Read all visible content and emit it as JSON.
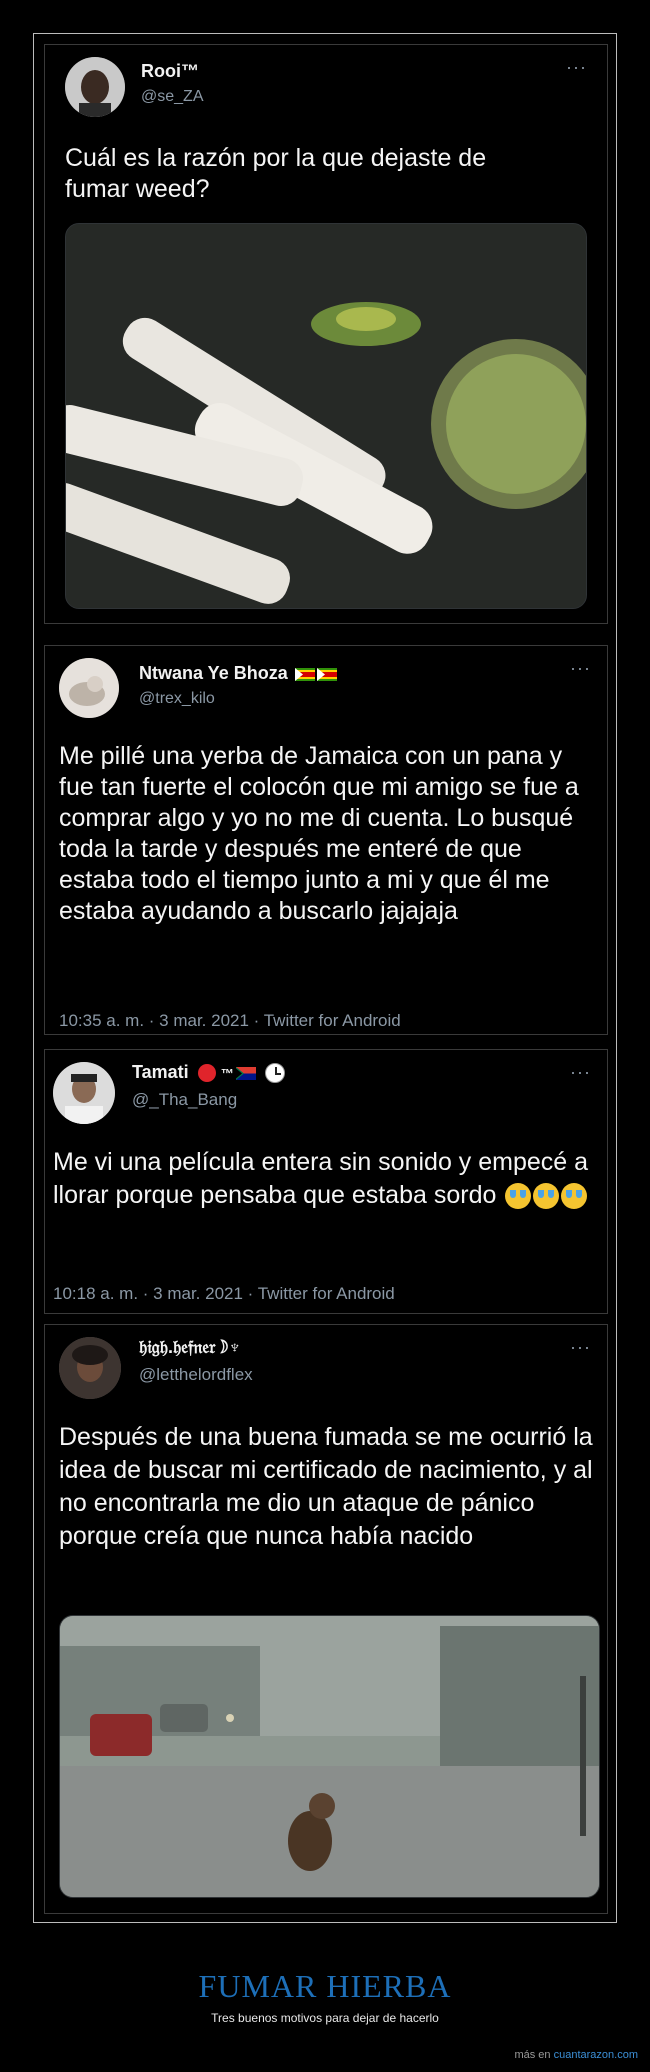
{
  "tweets": [
    {
      "name": "Rooi™",
      "handle": "@se_ZA",
      "text_line1": "Cuál es la razón por la que dejaste de",
      "text_line2": "fumar weed?",
      "more": "···"
    },
    {
      "name": "Ntwana Ye Bhoza",
      "handle": "@trex_kilo",
      "text": "Me pillé una yerba de Jamaica con un pana y fue tan fuerte el colocón que mi amigo se fue a comprar algo y yo no me di cuenta. Lo busqué toda la tarde y después me enteré de que estaba todo el tiempo junto a mi y que él me estaba ayudando a buscarlo jajajaja",
      "meta": "10:35 a. m. · 3 mar. 2021 · Twitter for Android",
      "more": "···"
    },
    {
      "name": "Tamati",
      "name_suffix": "™",
      "handle": "@_Tha_Bang",
      "text": "Me vi una película entera sin sonido y empecé a llorar porque pensaba que estaba sordo",
      "meta": "10:18 a. m. · 3 mar. 2021 · Twitter for Android",
      "more": "···"
    },
    {
      "name": "𝔥𝔦𝔤𝔥.𝔥𝔢𝔣𝔫𝔢𝔯☽︎♆",
      "handle": "@letthelordflex",
      "text": "Después de una buena fumada se me ocurrió la idea de buscar mi certificado de nacimiento, y al no encontrarla me dio un ataque de pánico porque creía que nunca había nacido",
      "more": "···"
    }
  ],
  "footer": {
    "title": "FUMAR HIERBA",
    "subtitle": "Tres buenos motivos para dejar de hacerlo",
    "credit_prefix": "más en",
    "credit_link": "cuantarazon.com"
  },
  "colors": {
    "accent": "#1d6fb8",
    "link": "#3c8fd6",
    "muted": "#8b98a5"
  }
}
